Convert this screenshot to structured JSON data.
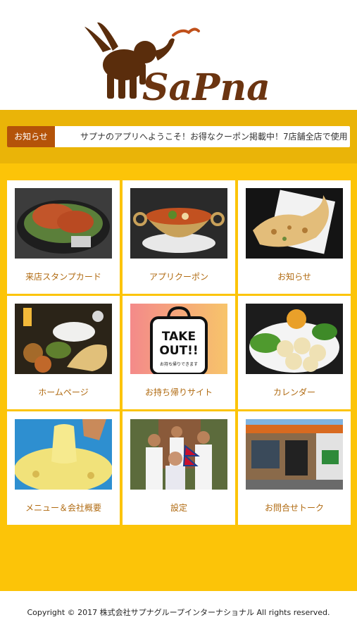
{
  "brand": {
    "logo_text": "SaPna"
  },
  "notice": {
    "label": "お知らせ",
    "text": "サプナのアプリへようこそ！お得なクーポン掲載中！7店舗全店で使用"
  },
  "menu": {
    "items": [
      {
        "label": "来店スタンプカード",
        "icon": "tandoori-chicken-photo"
      },
      {
        "label": "アプリクーポン",
        "icon": "curry-bowl-photo"
      },
      {
        "label": "お知らせ",
        "icon": "naan-photo"
      },
      {
        "label": "ホームページ",
        "icon": "meal-set-photo"
      },
      {
        "label": "お持ち帰りサイト",
        "icon": "takeout-bag-icon",
        "badge_line1": "TAKE",
        "badge_line2": "OUT!!",
        "badge_sub": "お持ち帰りできます"
      },
      {
        "label": "カレンダー",
        "icon": "momo-dumplings-photo"
      },
      {
        "label": "メニュー＆会社概要",
        "icon": "cheese-naan-photo"
      },
      {
        "label": "設定",
        "icon": "staff-photo"
      },
      {
        "label": "お問合せトーク",
        "icon": "storefront-photo"
      }
    ]
  },
  "footer": {
    "copyright": "Copyright © 2017 株式会社サプナグループインターナショナル All rights reserved."
  },
  "colors": {
    "accent_yellow": "#fcc408",
    "band_yellow": "#eab408",
    "label_brown": "#b45309",
    "tile_text": "#b06a10"
  }
}
